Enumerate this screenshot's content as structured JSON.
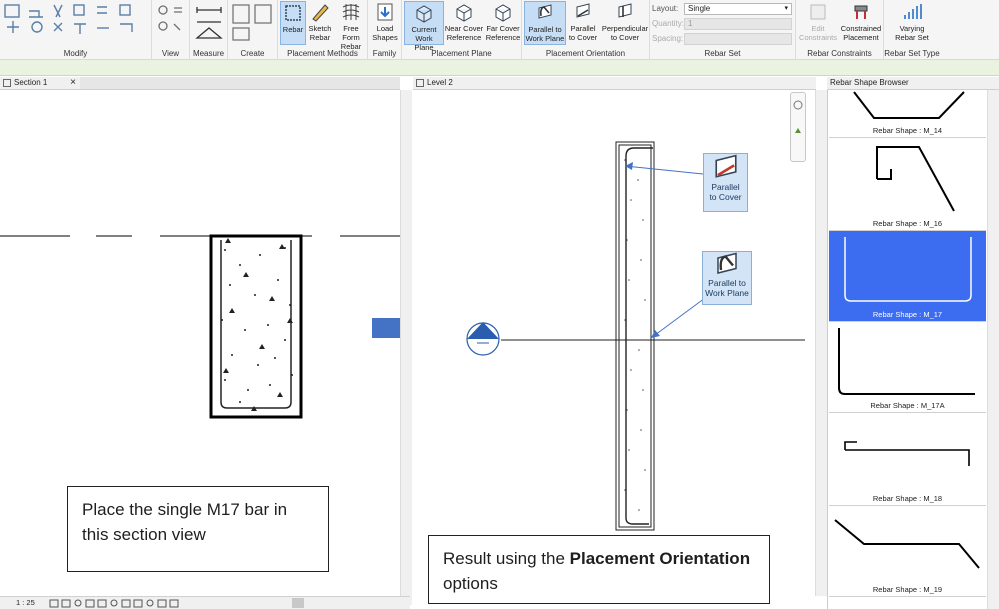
{
  "ribbon": {
    "panels": {
      "modify": "Modify",
      "view": "View",
      "measure": "Measure",
      "create": "Create",
      "placement_methods": "Placement Methods",
      "family": "Family",
      "placement_plane": "Placement Plane",
      "placement_orientation": "Placement Orientation",
      "rebar_set": "Rebar Set",
      "rebar_constraints": "Rebar Constraints",
      "rebar_set_type": "Rebar Set Type"
    },
    "buttons": {
      "rebar": "Rebar",
      "sketch_rebar_1": "Sketch",
      "sketch_rebar_2": "Rebar",
      "free_form_1": "Free Form",
      "free_form_2": "Rebar",
      "load_shapes_1": "Load",
      "load_shapes_2": "Shapes",
      "current_wp_1": "Current",
      "current_wp_2": "Work Plane",
      "near_cover_1": "Near Cover",
      "near_cover_2": "Reference",
      "far_cover_1": "Far Cover",
      "far_cover_2": "Reference",
      "parallel_wp_1": "Parallel to",
      "parallel_wp_2": "Work Plane",
      "parallel_cover_1": "Parallel",
      "parallel_cover_2": "to Cover",
      "perp_cover_1": "Perpendicular",
      "perp_cover_2": "to Cover",
      "edit_constraints_1": "Edit",
      "edit_constraints_2": "Constraints",
      "constrained_1": "Constrained",
      "constrained_2": "Placement",
      "varying_1": "Varying",
      "varying_2": "Rebar Set"
    },
    "layout_label": "Layout:",
    "layout_value": "Single",
    "quantity_label": "Quantity:",
    "quantity_value": "1",
    "spacing_label": "Spacing:"
  },
  "tabs": {
    "section": "Section 1",
    "level": "Level 2",
    "browser": "Rebar Shape Browser",
    "close": "×"
  },
  "annotations": {
    "left_box": "Place the single M17 bar in this section view",
    "right_box_prefix": "Result using the ",
    "right_box_bold": "Placement Orientation",
    "right_box_suffix": " options",
    "tip_cover_1": "Parallel",
    "tip_cover_2": "to Cover",
    "tip_wp_1": "Parallel to",
    "tip_wp_2": "Work Plane"
  },
  "browser": {
    "shapes": [
      {
        "caption": "Rebar Shape : M_14"
      },
      {
        "caption": "Rebar Shape : M_16"
      },
      {
        "caption": "Rebar Shape : M_17"
      },
      {
        "caption": "Rebar Shape : M_17A"
      },
      {
        "caption": "Rebar Shape : M_18"
      },
      {
        "caption": "Rebar Shape : M_19"
      }
    ]
  },
  "status": {
    "scale": "1 : 25"
  },
  "colors": {
    "selected": "#3c6cf0",
    "arrow": "#4472c4",
    "active_button": "#c5def5"
  }
}
